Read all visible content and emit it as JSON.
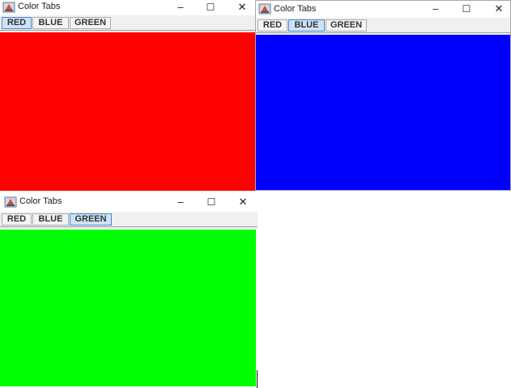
{
  "windows": [
    {
      "title": "Color Tabs",
      "tabs": [
        {
          "label": "RED",
          "selected": true
        },
        {
          "label": "BLUE",
          "selected": false
        },
        {
          "label": "GREEN",
          "selected": false
        }
      ],
      "panel_color": "#ff0000"
    },
    {
      "title": "Color Tabs",
      "tabs": [
        {
          "label": "RED",
          "selected": false
        },
        {
          "label": "BLUE",
          "selected": true
        },
        {
          "label": "GREEN",
          "selected": false
        }
      ],
      "panel_color": "#0000ff"
    },
    {
      "title": "Color Tabs",
      "tabs": [
        {
          "label": "RED",
          "selected": false
        },
        {
          "label": "BLUE",
          "selected": false
        },
        {
          "label": "GREEN",
          "selected": true
        }
      ],
      "panel_color": "#00ff00"
    }
  ],
  "controls": {
    "minimize_glyph": "–",
    "maximize_glyph": "☐",
    "close_glyph": "✕"
  },
  "icons": {
    "app": "java-cup-icon",
    "minimize": "minimize-icon",
    "maximize": "maximize-icon",
    "close": "close-icon"
  }
}
